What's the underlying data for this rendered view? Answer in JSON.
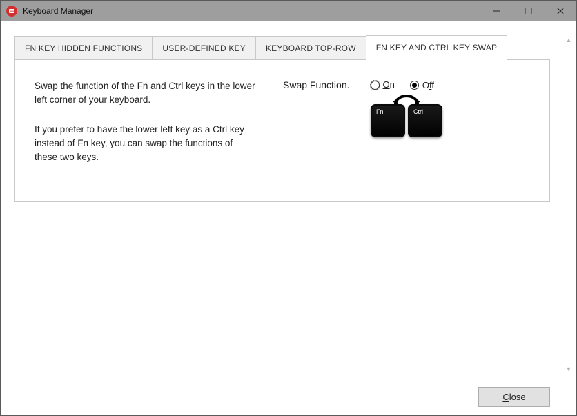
{
  "window": {
    "title": "Keyboard Manager"
  },
  "tabs": [
    {
      "label": "FN KEY HIDDEN FUNCTIONS"
    },
    {
      "label": "USER-DEFINED KEY"
    },
    {
      "label": "KEYBOARD TOP-ROW"
    },
    {
      "label": "FN KEY AND CTRL KEY SWAP"
    }
  ],
  "active_tab_index": 3,
  "panel": {
    "paragraph1": "Swap the function of the Fn and Ctrl keys in the lower left corner of your keyboard.",
    "paragraph2": "If you prefer to have the lower left key as a Ctrl key instead of Fn key, you can swap the functions of these two keys.",
    "swap_label": "Swap Function.",
    "radio_on_label": "On",
    "radio_off_label": "Off",
    "selected_radio": "off",
    "key_fn_label": "Fn",
    "key_ctrl_label": "Ctrl"
  },
  "buttons": {
    "close_label": "Close"
  },
  "icons": {
    "app": "app-icon",
    "minimize": "minimize-icon",
    "maximize": "maximize-icon",
    "close": "close-icon",
    "swap_arrow": "swap-arrow-icon"
  }
}
